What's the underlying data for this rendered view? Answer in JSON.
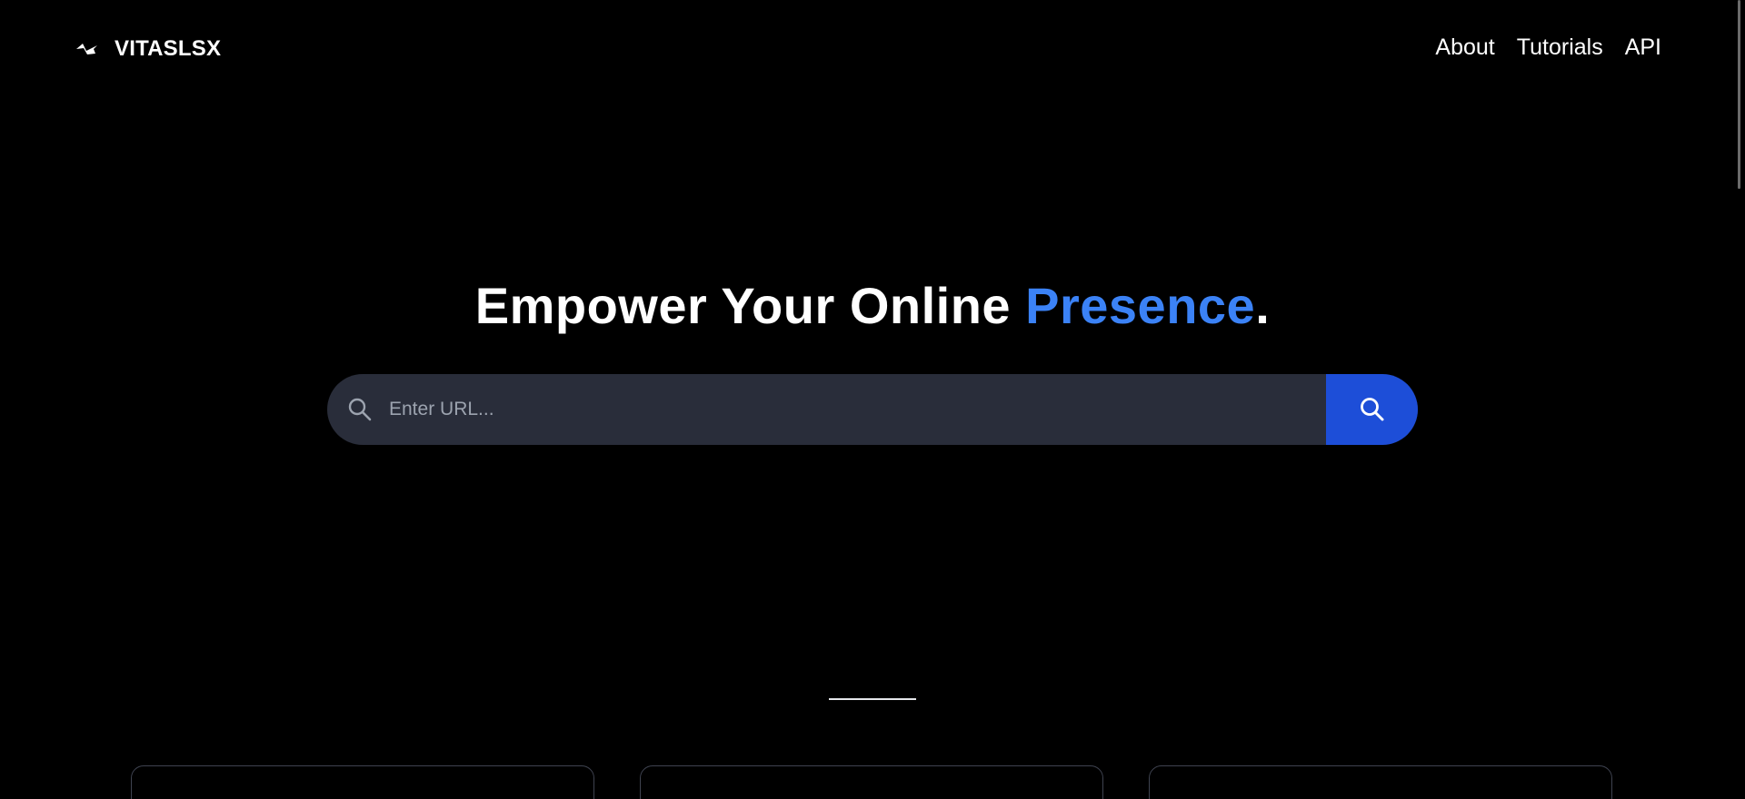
{
  "header": {
    "brand_name": "VITASLSX",
    "brand_icon": "swoosh-logo-icon",
    "nav": [
      {
        "label": "About"
      },
      {
        "label": "Tutorials"
      },
      {
        "label": "API"
      }
    ]
  },
  "hero": {
    "title_main": "Empower Your Online ",
    "title_accent": "Presence",
    "title_end": "."
  },
  "search": {
    "placeholder": "Enter URL...",
    "value": "",
    "leading_icon": "search-icon",
    "button_icon": "search-icon"
  },
  "colors": {
    "background": "#000000",
    "accent": "#3b82f6",
    "search_field_bg": "#292d3a",
    "search_button_bg": "#1d4ed8",
    "card_border": "#3f4350"
  }
}
